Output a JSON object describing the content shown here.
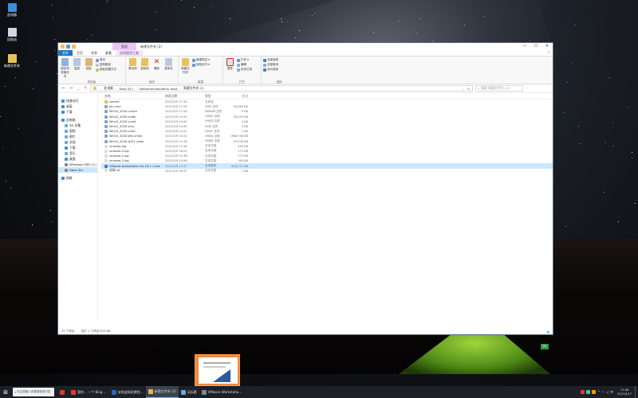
{
  "desktop": {
    "icons": [
      {
        "label": "此电脑",
        "icon": "computer-icon"
      },
      {
        "label": "回收站",
        "icon": "recycle-bin-icon"
      },
      {
        "label": "新建文件夹",
        "icon": "folder-icon"
      }
    ]
  },
  "window": {
    "title": "新建文件夹 (2)",
    "context_tab_group": "管理",
    "controls": {
      "minimize": "—",
      "maximize": "☐",
      "close": "✕"
    },
    "tabs": [
      "文件",
      "主页",
      "共享",
      "查看",
      "应用程序工具"
    ],
    "ribbon": {
      "clipboard": {
        "label": "剪贴板",
        "pin": "固定到快速访问",
        "copy": "复制",
        "paste": "粘贴",
        "cut": "剪切",
        "copy_path": "复制路径",
        "paste_shortcut": "粘贴快捷方式"
      },
      "organize": {
        "label": "组织",
        "move_to": "移动到",
        "copy_to": "复制到",
        "delete": "删除",
        "rename": "重命名"
      },
      "new": {
        "label": "新建",
        "new_folder": "新建文件夹",
        "new_item": "新建项目 ▾",
        "easy_access": "轻松访问 ▾"
      },
      "open": {
        "label": "打开",
        "properties": "属性",
        "open": "打开 ▾",
        "edit": "编辑",
        "history": "历史记录"
      },
      "select": {
        "label": "选择",
        "select_all": "全部选择",
        "select_none": "全部取消",
        "invert": "反向选择"
      }
    },
    "address": {
      "path": [
        "此电脑",
        "Data (D:)",
        "SoftwareInstallation tools",
        "新建文件夹 (2)"
      ],
      "search_placeholder": "搜索\"新建文件夹 (2)\""
    },
    "nav": [
      {
        "label": "快速访问",
        "icon": "star-icon",
        "sel": false
      },
      {
        "label": "桌面",
        "icon": "desktop-icon",
        "sel": false
      },
      {
        "label": "下载",
        "icon": "download-icon",
        "sel": false
      },
      {
        "label": "此电脑",
        "icon": "computer-icon",
        "sel": false
      },
      {
        "label": "3D 对象",
        "icon": "cube-icon",
        "sel": false
      },
      {
        "label": "视频",
        "icon": "video-icon",
        "sel": false
      },
      {
        "label": "图片",
        "icon": "picture-icon",
        "sel": false
      },
      {
        "label": "文档",
        "icon": "document-icon",
        "sel": false
      },
      {
        "label": "下载",
        "icon": "download-icon",
        "sel": false
      },
      {
        "label": "音乐",
        "icon": "music-icon",
        "sel": false
      },
      {
        "label": "桌面",
        "icon": "desktop-icon",
        "sel": false
      },
      {
        "label": "Windows-SSD (C:)",
        "icon": "drive-icon",
        "sel": false
      },
      {
        "label": "Data (D:)",
        "icon": "drive-icon",
        "sel": true
      },
      {
        "label": "网络",
        "icon": "network-icon",
        "sel": false
      }
    ],
    "columns": [
      "名称",
      "修改日期",
      "类型",
      "大小"
    ],
    "files": [
      {
        "name": "caches",
        "date": "2021/5/9 17:35",
        "type": "文件夹",
        "size": "",
        "color": "#e8b84a",
        "sel": false
      },
      {
        "name": "bin.vmx",
        "date": "2021/5/9 17:28",
        "type": "VMX 文件",
        "size": "16,383 KB",
        "color": "#8aa0c4",
        "sel": false
      },
      {
        "name": "Win10_2020.nvram",
        "date": "2021/5/9 17:28",
        "type": "NVRAM 文件",
        "size": "9 KB",
        "color": "#8aa0c4",
        "sel": false
      },
      {
        "name": "Win10_2020.vmdk",
        "date": "2021/5/9 14:32",
        "type": "VMDK 文件",
        "size": "26,205 KB",
        "color": "#8aa0c4",
        "sel": false
      },
      {
        "name": "Win10_2020.vmsd",
        "date": "2021/5/9 14:42",
        "type": "VMSD 文件",
        "size": "0 KB",
        "color": "#8aa0c4",
        "sel": false
      },
      {
        "name": "Win10_2020.vmx",
        "date": "2021/5/9 14:30",
        "type": "VMX 文件",
        "size": "3 KB",
        "color": "#8aa0c4",
        "sel": false
      },
      {
        "name": "Win10_2020.vmxf",
        "date": "2021/5/9 14:41",
        "type": "VMXF 文件",
        "size": "1 KB",
        "color": "#8aa0c4",
        "sel": false
      },
      {
        "name": "Win10_2020-Win.vmdk",
        "date": "2021/5/9 14:41",
        "type": "VMDK 文件",
        "size": "868,736 KB",
        "color": "#8aa0c4",
        "sel": false
      },
      {
        "name": "Win10_2020-s001.vmdk",
        "date": "2021/5/9 17:28",
        "type": "VMDK 文件",
        "size": "29,376 KB",
        "color": "#8aa0c4",
        "sel": false
      },
      {
        "name": "vmware.log",
        "date": "2021/5/9 17:28",
        "type": "文本文档",
        "size": "195 KB",
        "color": "#dcdcdc",
        "sel": false
      },
      {
        "name": "vmware-0.log",
        "date": "2021/5/9 16:02",
        "type": "文本文档",
        "size": "172 KB",
        "color": "#dcdcdc",
        "sel": false
      },
      {
        "name": "vmware-1.log",
        "date": "2021/5/9 15:36",
        "type": "文本文档",
        "size": "173 KB",
        "color": "#dcdcdc",
        "sel": false
      },
      {
        "name": "vmware-2.log",
        "date": "2021/5/9 14:56",
        "type": "文本文档",
        "size": "164 KB",
        "color": "#dcdcdc",
        "sel": false
      },
      {
        "name": "VMware-workstation-full-16.1.1.exe",
        "date": "2021/5/9 17:47",
        "type": "应用程序",
        "size": "620,771 KB",
        "color": "#4a7ab5",
        "sel": true
      },
      {
        "name": "说明.txt",
        "date": "2021/5/9 16:57",
        "type": "文本文档",
        "size": "1 KB",
        "color": "#dcdcdc",
        "sel": false
      }
    ],
    "status": {
      "count": "15 个项目",
      "selected": "选中 1 个项目 620 MB"
    }
  },
  "taskbar": {
    "search_placeholder": "在这里输入你要搜索的内容",
    "apps": [
      {
        "label": "",
        "icon": "edge-icon",
        "color": "#d33b2f",
        "active": false
      },
      {
        "label": "我的… 一个 Bing …",
        "icon": "browser-icon",
        "color": "#e33",
        "active": false
      },
      {
        "label": "安装虚拟机教程…",
        "icon": "word-icon",
        "color": "#2b65c8",
        "active": false
      },
      {
        "label": "新建文件夹 (2)",
        "icon": "folder-icon",
        "color": "#e8b84a",
        "active": true
      },
      {
        "label": "无标题",
        "icon": "notepad-icon",
        "color": "#6aa9d8",
        "active": false
      },
      {
        "label": "VMware Workstatio…",
        "icon": "vmware-icon",
        "color": "#888",
        "active": false
      }
    ],
    "clock_time": "17:48",
    "clock_date": "2021/5/17",
    "ime": "中"
  },
  "tray_badge": "EN"
}
